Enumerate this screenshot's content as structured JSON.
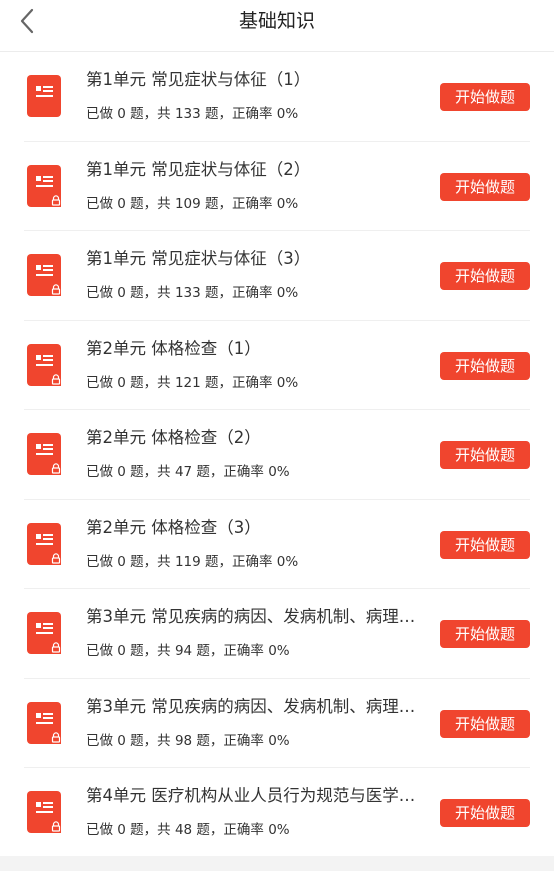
{
  "header": {
    "title": "基础知识",
    "back_icon": "chevron-left-icon"
  },
  "colors": {
    "accent": "#f0452e",
    "text": "#333333",
    "divider": "#efefef"
  },
  "items": [
    {
      "title": "第1单元 常见症状与体征（1）",
      "stats": "已做 0 题，共 133 题，正确率 0%",
      "button": "开始做题",
      "locked": false
    },
    {
      "title": "第1单元 常见症状与体征（2）",
      "stats": "已做 0 题，共 109 题，正确率 0%",
      "button": "开始做题",
      "locked": true
    },
    {
      "title": "第1单元 常见症状与体征（3）",
      "stats": "已做 0 题，共 133 题，正确率 0%",
      "button": "开始做题",
      "locked": true
    },
    {
      "title": "第2单元 体格检查（1）",
      "stats": "已做 0 题，共 121 题，正确率 0%",
      "button": "开始做题",
      "locked": true
    },
    {
      "title": "第2单元 体格检查（2）",
      "stats": "已做 0 题，共 47 题，正确率 0%",
      "button": "开始做题",
      "locked": true
    },
    {
      "title": "第2单元 体格检查（3）",
      "stats": "已做 0 题，共 119 题，正确率 0%",
      "button": "开始做题",
      "locked": true
    },
    {
      "title": "第3单元 常见疾病的病因、发病机制、病理…",
      "stats": "已做 0 题，共 94 题，正确率 0%",
      "button": "开始做题",
      "locked": true
    },
    {
      "title": "第3单元 常见疾病的病因、发病机制、病理…",
      "stats": "已做 0 题，共 98 题，正确率 0%",
      "button": "开始做题",
      "locked": true
    },
    {
      "title": "第4单元 医疗机构从业人员行为规范与医学…",
      "stats": "已做 0 题，共 48 题，正确率 0%",
      "button": "开始做题",
      "locked": true
    }
  ]
}
